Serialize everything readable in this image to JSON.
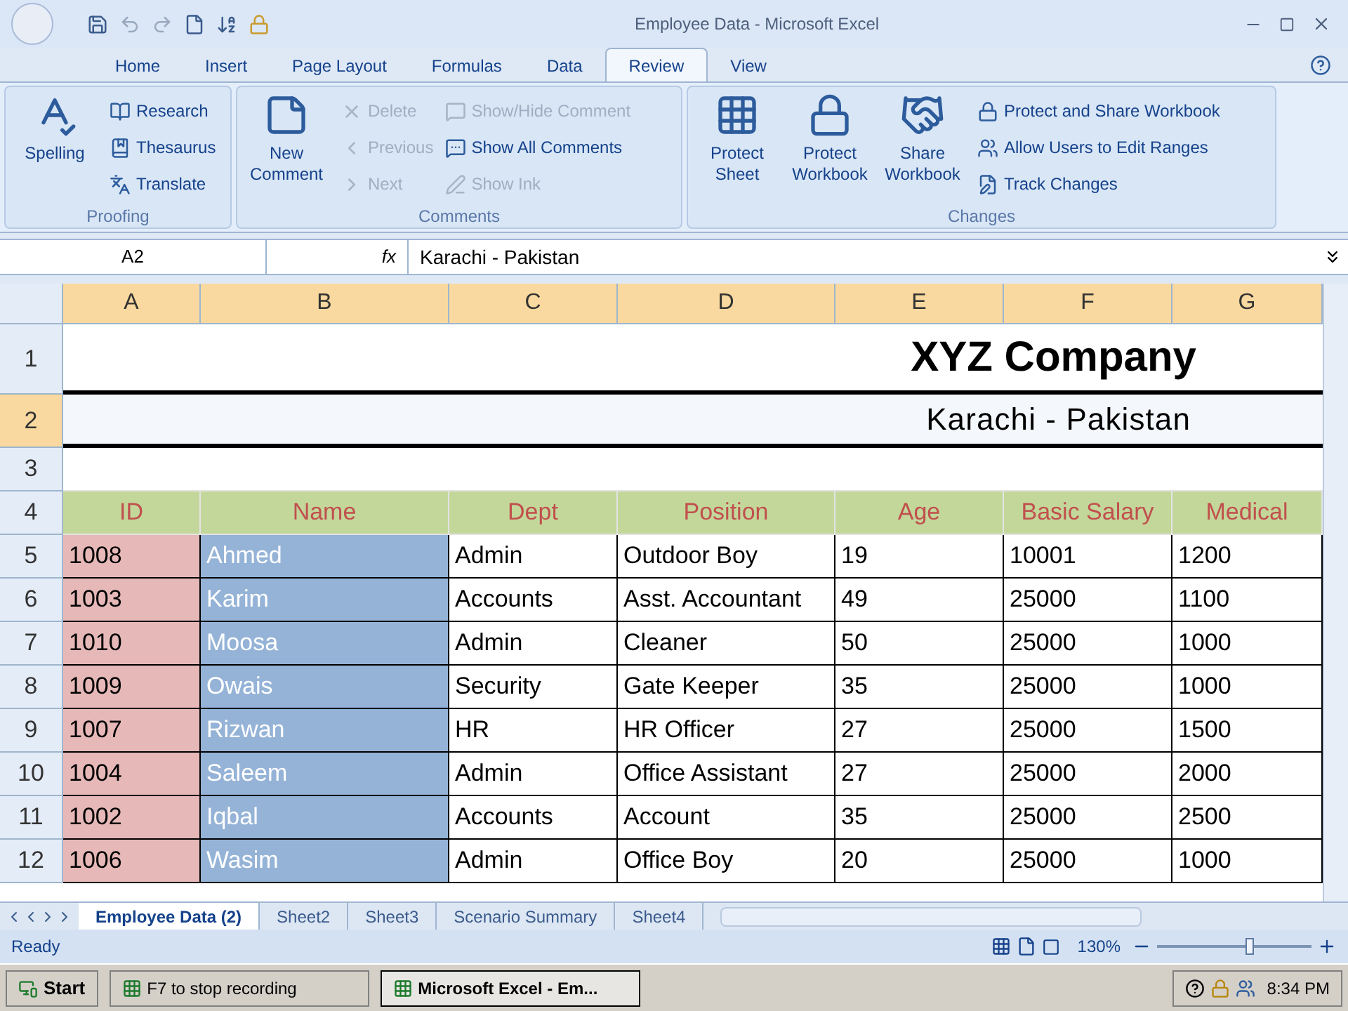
{
  "window": {
    "title": "Employee Data - Microsoft Excel"
  },
  "tabs": [
    {
      "label": "Home",
      "selected": false
    },
    {
      "label": "Insert",
      "selected": false
    },
    {
      "label": "Page Layout",
      "selected": false
    },
    {
      "label": "Formulas",
      "selected": false
    },
    {
      "label": "Data",
      "selected": false
    },
    {
      "label": "Review",
      "selected": true
    },
    {
      "label": "View",
      "selected": false
    }
  ],
  "ribbon": {
    "groups": [
      {
        "title": "Proofing",
        "large": [
          {
            "label": "Spelling",
            "kind": "spelling",
            "disabled": false
          }
        ],
        "small": [
          {
            "label": "Research",
            "kind": "research",
            "disabled": false
          },
          {
            "label": "Thesaurus",
            "kind": "thesaurus",
            "disabled": false
          },
          {
            "label": "Translate",
            "kind": "translate",
            "disabled": false
          }
        ]
      },
      {
        "title": "Comments",
        "large": [
          {
            "label": "New Comment",
            "kind": "comment",
            "disabled": false
          }
        ],
        "small": [
          {
            "label": "Delete",
            "kind": "delete",
            "disabled": true
          },
          {
            "label": "Previous",
            "kind": "previous",
            "disabled": true
          },
          {
            "label": "Next",
            "kind": "next",
            "disabled": true
          },
          {
            "label": "Show/Hide Comment",
            "kind": "showhide",
            "disabled": true
          },
          {
            "label": "Show All Comments",
            "kind": "showall",
            "disabled": false
          },
          {
            "label": "Show Ink",
            "kind": "ink",
            "disabled": true
          }
        ]
      },
      {
        "title": "Changes",
        "large": [
          {
            "label": "Protect Sheet",
            "kind": "protect",
            "disabled": false
          },
          {
            "label": "Protect Workbook",
            "kind": "protectbook",
            "disabled": false
          },
          {
            "label": "Share Workbook",
            "kind": "share",
            "disabled": false
          }
        ],
        "small": [
          {
            "label": "Protect and Share Workbook",
            "kind": "protectshare",
            "disabled": false
          },
          {
            "label": "Allow Users to Edit Ranges",
            "kind": "allow",
            "disabled": false
          },
          {
            "label": "Track Changes",
            "kind": "track",
            "disabled": false
          }
        ]
      }
    ]
  },
  "formula_bar": {
    "name_box": "A2",
    "function_label": "fx",
    "value": "Karachi - Pakistan"
  },
  "columns": [
    {
      "label": "A",
      "selected": true
    },
    {
      "label": "B",
      "selected": true
    },
    {
      "label": "C",
      "selected": true
    },
    {
      "label": "D",
      "selected": true
    },
    {
      "label": "E",
      "selected": true
    },
    {
      "label": "F",
      "selected": true
    },
    {
      "label": "G",
      "selected": true
    }
  ],
  "rows": [
    {
      "number": "1",
      "selected": false,
      "kind": "title",
      "text": "XYZ Company"
    },
    {
      "number": "2",
      "selected": true,
      "kind": "subtitle",
      "text": "Karachi - Pakistan"
    },
    {
      "number": "3",
      "selected": false,
      "kind": "blank"
    },
    {
      "number": "4",
      "selected": false,
      "kind": "header",
      "cells": [
        "ID",
        "Name",
        "Dept",
        "Position",
        "Age",
        "Basic Salary",
        "Medical"
      ]
    },
    {
      "number": "5",
      "selected": false,
      "kind": "data",
      "cells": [
        "1008",
        "Ahmed",
        "Admin",
        "Outdoor Boy",
        "19",
        "10001",
        "1200"
      ]
    },
    {
      "number": "6",
      "selected": false,
      "kind": "data",
      "cells": [
        "1003",
        "Karim",
        "Accounts",
        "Asst. Accountant",
        "49",
        "25000",
        "1100"
      ]
    },
    {
      "number": "7",
      "selected": false,
      "kind": "data",
      "cells": [
        "1010",
        "Moosa",
        "Admin",
        "Cleaner",
        "50",
        "25000",
        "1000"
      ]
    },
    {
      "number": "8",
      "selected": false,
      "kind": "data",
      "cells": [
        "1009",
        "Owais",
        "Security",
        "Gate Keeper",
        "35",
        "25000",
        "1000"
      ]
    },
    {
      "number": "9",
      "selected": false,
      "kind": "data",
      "cells": [
        "1007",
        "Rizwan",
        "HR",
        "HR Officer",
        "27",
        "25000",
        "1500"
      ]
    },
    {
      "number": "10",
      "selected": false,
      "kind": "data",
      "cells": [
        "1004",
        "Saleem",
        "Admin",
        "Office Assistant",
        "27",
        "25000",
        "2000"
      ]
    },
    {
      "number": "11",
      "selected": false,
      "kind": "data",
      "cells": [
        "1002",
        "Iqbal",
        "Accounts",
        "Account",
        "35",
        "25000",
        "2500"
      ]
    },
    {
      "number": "12",
      "selected": false,
      "kind": "data",
      "cells": [
        "1006",
        "Wasim",
        "Admin",
        "Office Boy",
        "20",
        "25000",
        "1000"
      ]
    }
  ],
  "sheet_tabs": [
    {
      "label": "Employee Data (2)",
      "selected": true
    },
    {
      "label": "Sheet2",
      "selected": false
    },
    {
      "label": "Sheet3",
      "selected": false
    },
    {
      "label": "Scenario Summary",
      "selected": false
    },
    {
      "label": "Sheet4",
      "selected": false
    }
  ],
  "status_bar": {
    "text": "Ready",
    "zoom": "130%",
    "level": 0.6
  },
  "taskbar": {
    "start": "Start",
    "buttons": [
      {
        "label": "F7 to stop recording",
        "selected": false
      },
      {
        "label": "Microsoft Excel - Em...",
        "selected": true
      }
    ],
    "clock": "8:34 PM"
  }
}
